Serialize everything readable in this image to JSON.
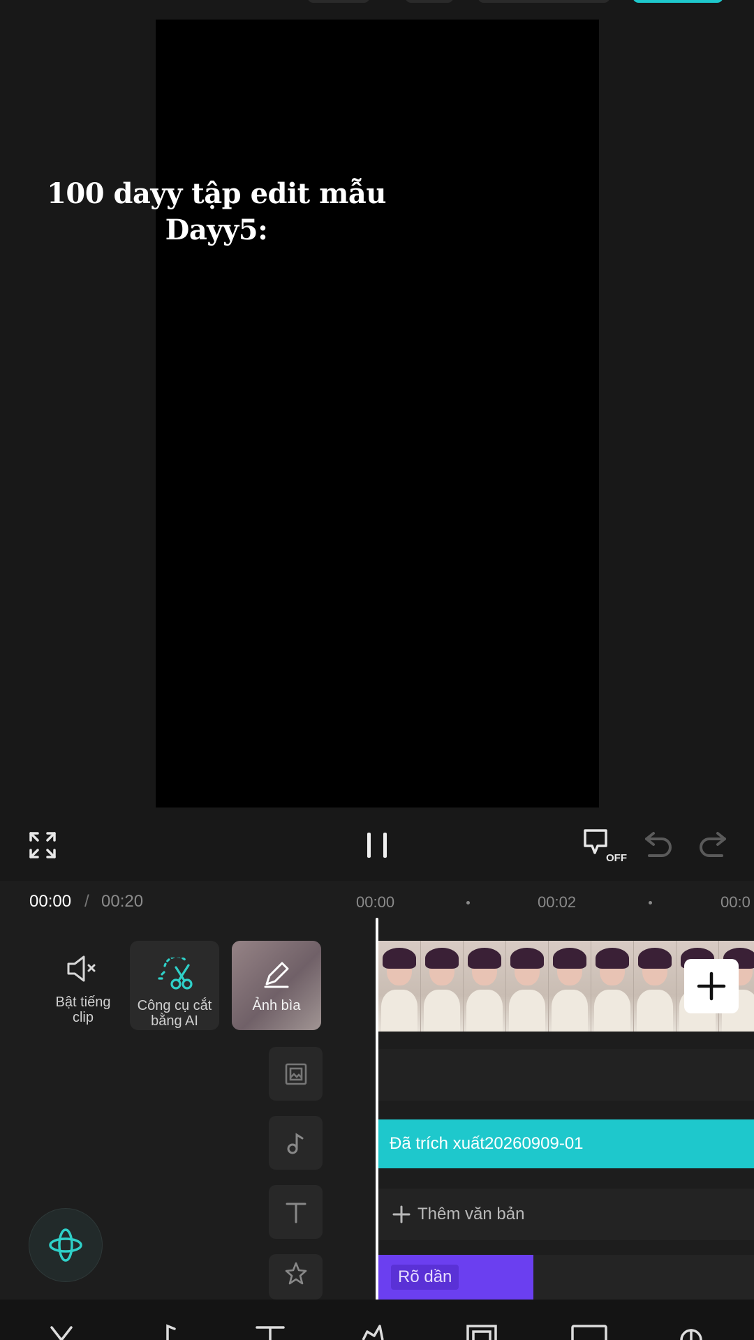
{
  "preview": {
    "overlay_line1": "100 dayy tập edit mẫu",
    "overlay_line2": "Dayy5:"
  },
  "controls": {
    "off_label": "OFF"
  },
  "time": {
    "current": "00:00",
    "separator": "/",
    "total": "00:20"
  },
  "ruler": {
    "t0": "00:00",
    "t1": "00:02",
    "t2": "00:0"
  },
  "tools": {
    "unmute_line1": "Bật tiếng",
    "unmute_line2": "clip",
    "ai_cut_line1": "Công cụ cắt",
    "ai_cut_line2": "bằng AI",
    "cover_label": "Ảnh bìa"
  },
  "tracks": {
    "audio_label": "Đã trích xuất20260909-01",
    "add_text_label": "Thêm văn bản",
    "effect_label": "Rõ dần"
  },
  "colors": {
    "accent": "#1ec8cc",
    "effect": "#6b3ff0"
  }
}
